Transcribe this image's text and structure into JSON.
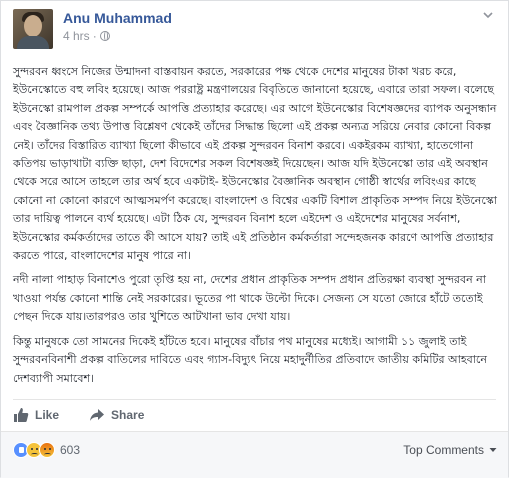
{
  "post": {
    "author": "Anu Muhammad",
    "time": "4 hrs",
    "time_separator": "·",
    "paragraphs": [
      "সুন্দরবন ধ্বংসে নিজের উন্মাদনা বাস্তবায়ন করতে, সরকারের পক্ষ থেকে দেশের মানুষের টাকা খরচ করে, ইউনেস্কোতে বহু লবিং হয়েছে। আজ পররাষ্ট্র মন্ত্রণালয়ের বিবৃতিতে জানানো হয়েছে, এবারে তারা সফল। বলেছে ইউনেস্কো রামপাল প্রকল্প সম্পর্কে আপত্তি প্রত্যাহার করেছে। এর আগে ইউনেস্কোর বিশেষজ্ঞদের ব্যাপক অনুসন্ধান এবং বৈজ্ঞানিক তথ্য উপাত্ত বিশ্লেষণ থেকেই তাঁদের সিদ্ধান্ত ছিলো এই প্রকল্প অন্যত্র সরিয়ে নেবার কোনো বিকল্প নেই। তাঁদের বিস্তারিত ব্যাখ্যা ছিলো কীভাবে এই প্রকল্প সুন্দরবন বিনাশ করবে। একইরকম ব্যাখ্যা, হাতেগোনা কতিপয় ভাড়াখাটা ব্যক্তি ছাড়া, দেশ বিদেশের সকল বিশেষজ্ঞই দিয়েছেন। আজ যদি ইউনেস্কো তার এই অবস্থান থেকে সরে আসে তাহলে তার অর্থ হবে একটাই- ইউনেস্কোর বৈজ্ঞানিক অবস্থান গোষ্ঠী স্বার্থের লবিংএর কাছে কোনো না কোনো কারণে আত্মসমর্পণ করেছে। বাংলাদেশ ও বিশ্বের একটি বিশাল প্রাকৃতিক সম্পদ নিয়ে ইউনেস্কো তার দায়িত্ব পালনে ব্যর্থ হয়েছে। এটা ঠিক যে, সুন্দরবন বিনাশ হলে এইদেশ ও এইদেশের মানুষের সর্বনাশ, ইউনেস্কোর কর্মকর্তাদের তাতে কী আসে যায়? তাই এই প্রতিষ্ঠান কর্মকর্তারা সন্দেহজনক কারণে আপত্তি প্রত্যাহার করতে পারে, বাংলাদেশের মানুষ পারে না।",
      "নদী নালা পাহাড় বিনাশেও পুরো তৃপ্তি হয় না, দেশের প্রধান প্রাকৃতিক সম্পদ প্রধান প্রতিরক্ষা ব্যবস্থা সুন্দরবন না খাওয়া পর্যন্ত কোনো শান্তি নেই সরকারের। ভূতের পা থাকে উল্টো দিকে। সেজন্য সে যতো জোরে হাঁটে ততোই পেছন দিকে যায়।তারপরও তার খুশিতে আটখানা ভাব দেখা যায়।",
      "কিন্তু মানুষকে তো সামনের দিকেই হাঁটতে হবে। মানুষের বাঁচার পথ মানুষের মধ্যেই। আগামী ১১ জুলাই তাই সুন্দরবনবিনাশী প্রকল্প বাতিলের দাবিতে এবং গ্যাস-বিদ্যুৎ নিয়ে মহাদুর্নীতির প্রতিবাদে জাতীয় কমিটির আহবানে দেশব্যাপী সমাবেশ।"
    ]
  },
  "actions": {
    "like_label": "Like",
    "share_label": "Share"
  },
  "reactions": {
    "count": "603",
    "sort_label": "Top Comments"
  },
  "colors": {
    "author_link": "#365899",
    "meta_gray": "#90949c",
    "like_blue": "#5890ff"
  },
  "icons": [
    "globe-icon",
    "chevron-down-icon",
    "like-thumb-icon",
    "share-arrow-icon",
    "like-reaction-icon",
    "sad-reaction-icon",
    "angry-reaction-icon"
  ]
}
